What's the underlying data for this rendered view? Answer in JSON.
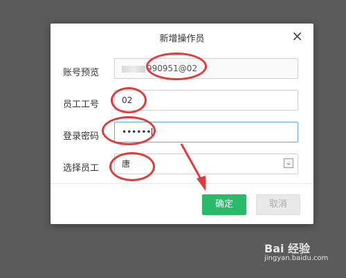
{
  "dialog": {
    "title": "新增操作员",
    "close_glyph": "×"
  },
  "form": {
    "account_preview": {
      "label": "账号预览",
      "value": "990951@02"
    },
    "employee_no": {
      "label": "员工工号",
      "value": "02"
    },
    "password": {
      "label": "登录密码",
      "value": "••••••"
    },
    "employee_select": {
      "label": "选择员工",
      "value": "唐",
      "arrow_glyph": "⌄"
    }
  },
  "buttons": {
    "confirm": "确定",
    "cancel": "取消"
  },
  "watermark": {
    "logo": "Bai 经验",
    "url": "jingyan.baidu.com"
  },
  "annotation_color": "#e23a3a",
  "accent_color": "#2aba6a"
}
